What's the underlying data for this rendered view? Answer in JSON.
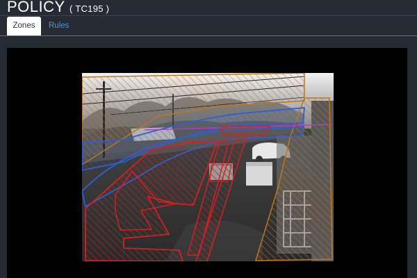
{
  "page": {
    "title": "POLICY",
    "subtitle": "( TC195 )"
  },
  "tabs": [
    {
      "label": "Zones",
      "active": true
    },
    {
      "label": "Rules",
      "active": false
    }
  ],
  "colors": {
    "background": "#262b33",
    "tab_link": "#4a9ad8",
    "zone_red": "#d42020",
    "zone_orange": "#c6741c",
    "zone_blue": "#2d5fd6",
    "line_magenta": "#b03cc8"
  }
}
